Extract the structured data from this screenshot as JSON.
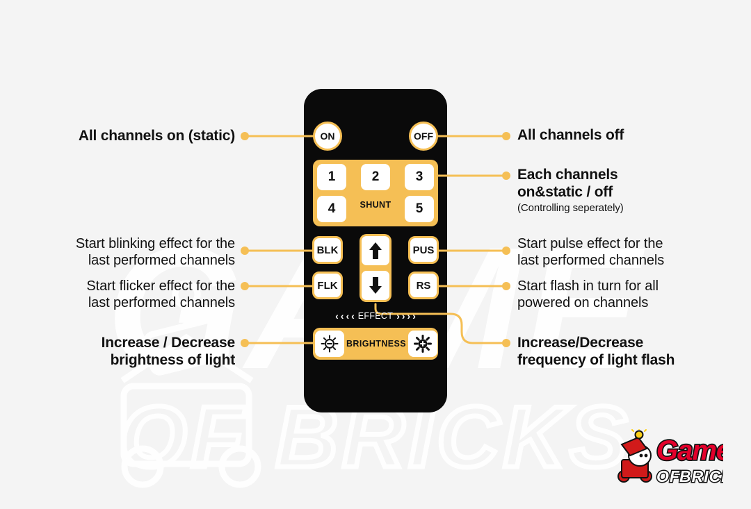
{
  "theme": {
    "background": "#f4f4f4",
    "accent": "#f5bf55",
    "remote_body": "#0a0a0a",
    "button_face": "#ffffff",
    "text": "#111111",
    "logo_red": "#e4002b"
  },
  "remote": {
    "power": {
      "on_label": "ON",
      "off_label": "OFF"
    },
    "shunt": {
      "panel_label": "SHUNT",
      "buttons": [
        "1",
        "2",
        "3",
        "4",
        "5"
      ]
    },
    "effect_buttons": {
      "blk": "BLK",
      "flk": "FLK",
      "pus": "PUS",
      "rs": "RS"
    },
    "arrows": {
      "up_icon": "arrow-up-icon",
      "down_icon": "arrow-down-icon"
    },
    "effect_row": {
      "label": "EFFECT",
      "left_chevrons": [
        "‹",
        "‹",
        "‹",
        "‹"
      ],
      "right_chevrons": [
        "›",
        "›",
        "›",
        "›"
      ]
    },
    "brightness": {
      "label": "BRIGHTNESS",
      "decrease_icon": "sun-minus-icon",
      "increase_icon": "sun-plus-icon"
    }
  },
  "callouts": {
    "left": [
      {
        "id": "all-on",
        "line1": "All channels on (static)",
        "style": "bold"
      },
      {
        "id": "blink",
        "line1": "Start blinking effect for the",
        "line2": "last performed channels",
        "style": "regular"
      },
      {
        "id": "flicker",
        "line1": "Start flicker effect for the",
        "line2": "last performed channels",
        "style": "regular"
      },
      {
        "id": "brightness",
        "line1": "Increase / Decrease",
        "line2": "brightness of light",
        "style": "bold"
      }
    ],
    "right": [
      {
        "id": "all-off",
        "line1": "All channels off",
        "style": "bold"
      },
      {
        "id": "each-channel",
        "line1": "Each channels",
        "line2": "on&static / off",
        "sub": "(Controlling seperately)",
        "style": "bold"
      },
      {
        "id": "pulse",
        "line1": "Start pulse effect for the",
        "line2": "last performed channels",
        "style": "regular"
      },
      {
        "id": "flash-turn",
        "line1": "Start flash in turn for all",
        "line2": "powered on channels",
        "style": "regular"
      },
      {
        "id": "frequency",
        "line1": "Increase/Decrease",
        "line2": "frequency of light flash",
        "style": "bold"
      }
    ]
  },
  "watermark": {
    "line1": "GAME",
    "line2": "OF BRICKS"
  },
  "logo": {
    "word1": "Game",
    "word2": "OF",
    "word3": "BRICKS"
  }
}
